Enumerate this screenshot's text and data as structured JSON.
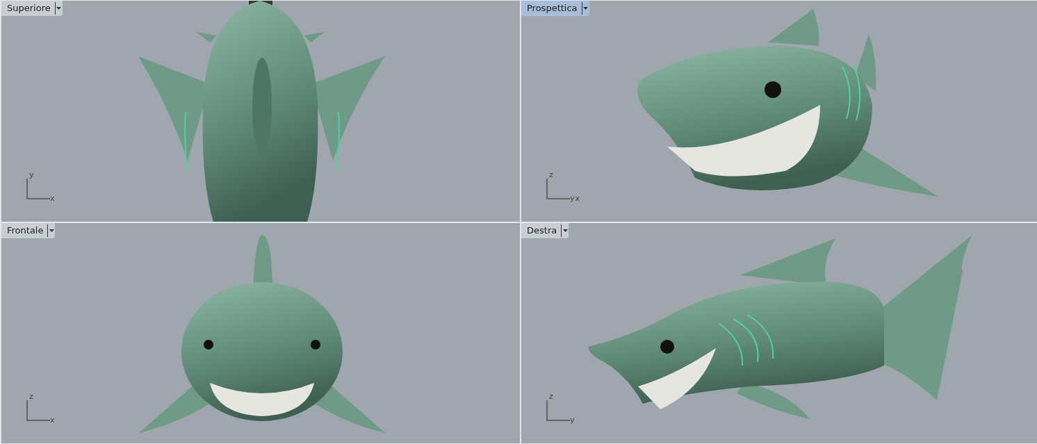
{
  "viewports": [
    {
      "title": "Superiore",
      "selected": false,
      "kind": "top",
      "axis_vertical": "y",
      "axis_horizontal": [
        "x"
      ]
    },
    {
      "title": "Prospettica",
      "selected": true,
      "kind": "perspective",
      "axis_vertical": "z",
      "axis_horizontal": [
        "y",
        "x"
      ]
    },
    {
      "title": "Frontale",
      "selected": false,
      "kind": "front",
      "axis_vertical": "z",
      "axis_horizontal": [
        "x"
      ]
    },
    {
      "title": "Destra",
      "selected": false,
      "kind": "right",
      "axis_vertical": "z",
      "axis_horizontal": [
        "y"
      ]
    }
  ]
}
